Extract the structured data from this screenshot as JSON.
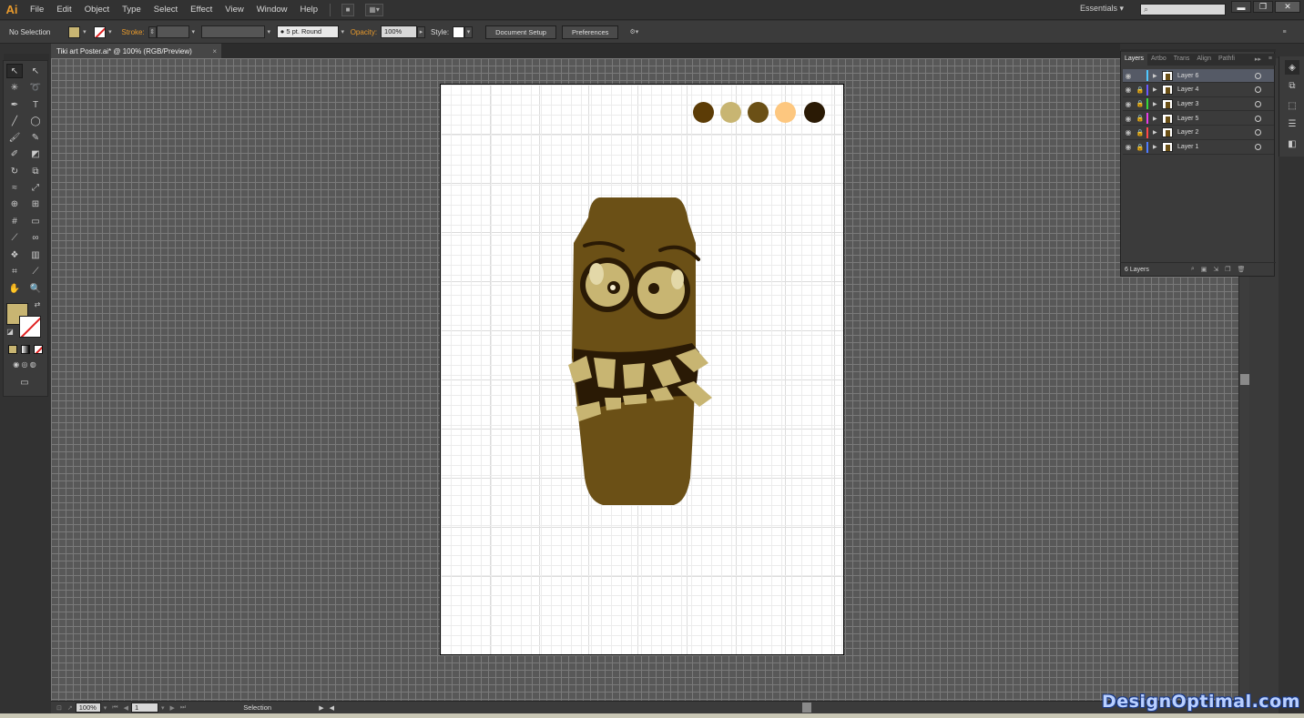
{
  "app": {
    "logo": "Ai"
  },
  "menu": [
    "File",
    "Edit",
    "Object",
    "Type",
    "Select",
    "Effect",
    "View",
    "Window",
    "Help"
  ],
  "workspace": {
    "label": "Essentials",
    "arrow": "▾"
  },
  "window_controls": {
    "minimize": "▬",
    "restore": "❐",
    "close": "✕"
  },
  "control_bar": {
    "selection": "No Selection",
    "fill_color": "#c8b572",
    "stroke_label": "Stroke:",
    "brush_value": "5 pt. Round",
    "opacity_label": "Opacity:",
    "opacity_value": "100%",
    "style_label": "Style:",
    "document_setup": "Document Setup",
    "preferences": "Preferences"
  },
  "document": {
    "tab_title": "Tiki art Poster.ai* @ 100% (RGB/Preview)",
    "close": "×"
  },
  "artboard": {
    "palette": [
      "#5c3c06",
      "#c8b572",
      "#6b5016",
      "#fdc77f",
      "#2a1a05"
    ],
    "tiki_colors": {
      "body": "#6b5016",
      "dark": "#2a1a05",
      "teeth": "#c8b572",
      "eye": "#c8b572",
      "pupil": "#2a1a05"
    }
  },
  "status_bar": {
    "zoom": "100%",
    "artboard_number": "1",
    "tool": "Selection"
  },
  "layers_panel": {
    "tabs": [
      "Layers",
      "Artbo",
      "Trans",
      "Align",
      "Pathfi"
    ],
    "layers": [
      {
        "name": "Layer 6",
        "color": "#4fc8ff",
        "selected": true
      },
      {
        "name": "Layer 4",
        "color": "#6a5aff"
      },
      {
        "name": "Layer 3",
        "color": "#39d839"
      },
      {
        "name": "Layer 5",
        "color": "#e83fe8"
      },
      {
        "name": "Layer 2",
        "color": "#ff4848"
      },
      {
        "name": "Layer 1",
        "color": "#4f7cff"
      }
    ],
    "footer": "6 Layers"
  },
  "watermark": "DesignOptimal.com"
}
